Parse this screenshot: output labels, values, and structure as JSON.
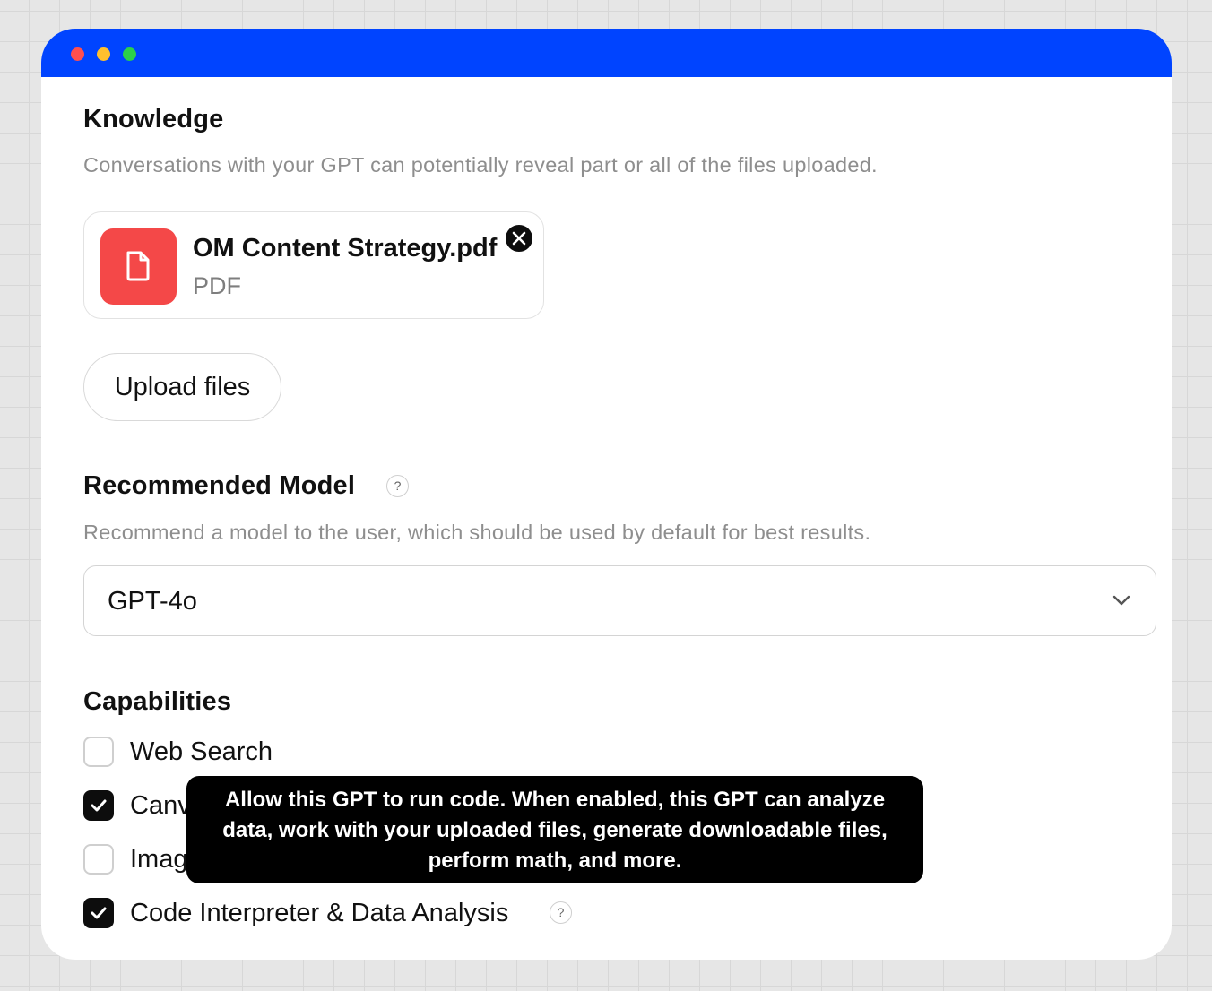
{
  "knowledge": {
    "title": "Knowledge",
    "description": "Conversations with your GPT can potentially reveal part or all of the files uploaded.",
    "file": {
      "name": "OM Content Strategy.pdf",
      "type": "PDF",
      "icon": "document-icon",
      "icon_color": "#f44848"
    },
    "upload_label": "Upload files"
  },
  "model": {
    "title": "Recommended Model",
    "help": "?",
    "description": "Recommend a model to the user, which should be used by default for best results.",
    "selected": "GPT-4o"
  },
  "capabilities": {
    "title": "Capabilities",
    "items": [
      {
        "label": "Web Search",
        "checked": false
      },
      {
        "label": "Canvas",
        "checked": true
      },
      {
        "label": "Image Generation",
        "checked": false
      },
      {
        "label": "Code Interpreter & Data Analysis",
        "checked": true
      }
    ],
    "help": "?",
    "tooltip": [
      "Allow this GPT to run code. When enabled, this GPT can analyze",
      "data, work with your uploaded files, generate downloadable files,",
      "perform math, and more."
    ]
  },
  "theme": {
    "titlebar_color": "#0044ff",
    "accent": "#0d0d0d"
  }
}
